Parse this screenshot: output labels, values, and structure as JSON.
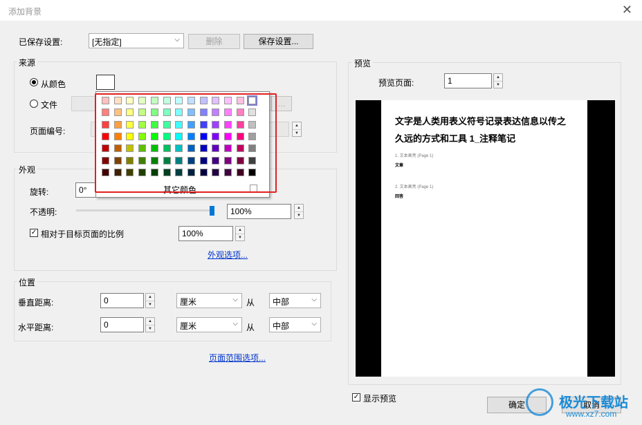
{
  "dialog": {
    "title": "添加背景"
  },
  "saved": {
    "label": "已保存设置:",
    "value": "[无指定]",
    "delete_label": "删除",
    "save_label": "保存设置..."
  },
  "source": {
    "title": "来源",
    "color_label": "从颜色",
    "file_label": "文件",
    "page_number_label": "页面编号:"
  },
  "palette": {
    "other_colors": "其它颜色",
    "rows": [
      [
        "#ffc0c0",
        "#ffe0c0",
        "#ffffc0",
        "#e0ffc0",
        "#c0ffc0",
        "#c0ffe0",
        "#c0ffff",
        "#c0e0ff",
        "#c0c0ff",
        "#e0c0ff",
        "#ffc0ff",
        "#ffc0e0",
        "#ffffff"
      ],
      [
        "#ff8080",
        "#ffc080",
        "#ffff80",
        "#c0ff80",
        "#80ff80",
        "#80ffc0",
        "#80ffff",
        "#80c0ff",
        "#8080ff",
        "#c080ff",
        "#ff80ff",
        "#ff80c0",
        "#e0e0e0"
      ],
      [
        "#ff4040",
        "#ffa040",
        "#ffff40",
        "#a0ff40",
        "#40ff40",
        "#40ffa0",
        "#40ffff",
        "#40a0ff",
        "#4040ff",
        "#a040ff",
        "#ff40ff",
        "#ff40a0",
        "#c0c0c0"
      ],
      [
        "#ff0000",
        "#ff8000",
        "#ffff00",
        "#80ff00",
        "#00ff00",
        "#00ff80",
        "#00ffff",
        "#0080ff",
        "#0000ff",
        "#8000ff",
        "#ff00ff",
        "#ff0080",
        "#a0a0a0"
      ],
      [
        "#c00000",
        "#c06000",
        "#c0c000",
        "#60c000",
        "#00c000",
        "#00c060",
        "#00c0c0",
        "#0060c0",
        "#0000c0",
        "#6000c0",
        "#c000c0",
        "#c00060",
        "#808080"
      ],
      [
        "#800000",
        "#804000",
        "#808000",
        "#408000",
        "#008000",
        "#008040",
        "#008080",
        "#004080",
        "#000080",
        "#400080",
        "#800080",
        "#800040",
        "#404040"
      ],
      [
        "#400000",
        "#402000",
        "#404000",
        "#204000",
        "#004000",
        "#004020",
        "#004040",
        "#002040",
        "#000040",
        "#200040",
        "#400040",
        "#400020",
        "#000000"
      ]
    ]
  },
  "appearance": {
    "title": "外观",
    "rotation_label": "旋转:",
    "rotation_value": "0°",
    "opacity_label": "不透明:",
    "opacity_value": "100%",
    "opacity_level": 1.0,
    "scale_label": "相对于目标页面的比例",
    "scale_value": "100%",
    "options_link": "外观选项..."
  },
  "position": {
    "title": "位置",
    "vertical_label": "垂直距离:",
    "vertical_value": "0",
    "vertical_unit": "厘米",
    "vertical_from": "从",
    "vertical_anchor": "中部",
    "horizontal_label": "水平距离:",
    "horizontal_value": "0",
    "horizontal_unit": "厘米",
    "horizontal_from": "从",
    "horizontal_anchor": "中部"
  },
  "page_range_link": "页面范围选项...",
  "preview": {
    "title": "预览",
    "page_label": "预览页面:",
    "page_value": "1",
    "doc_title": "文字是人类用表义符号记录表达信息以传之久远的方式和工具 1_注释笔记",
    "item1_heading": "1. 文本高亮 (Page 1)",
    "item1_text": "文章",
    "item2_heading": "2. 文本高亮 (Page 1)",
    "item2_text": "回答",
    "show_preview_label": "显示预览"
  },
  "buttons": {
    "ok": "确定",
    "cancel": "取消"
  },
  "watermark": {
    "line1": "极光下载站",
    "line2": "www.xz7.com"
  },
  "highlight_color": "#e02020"
}
